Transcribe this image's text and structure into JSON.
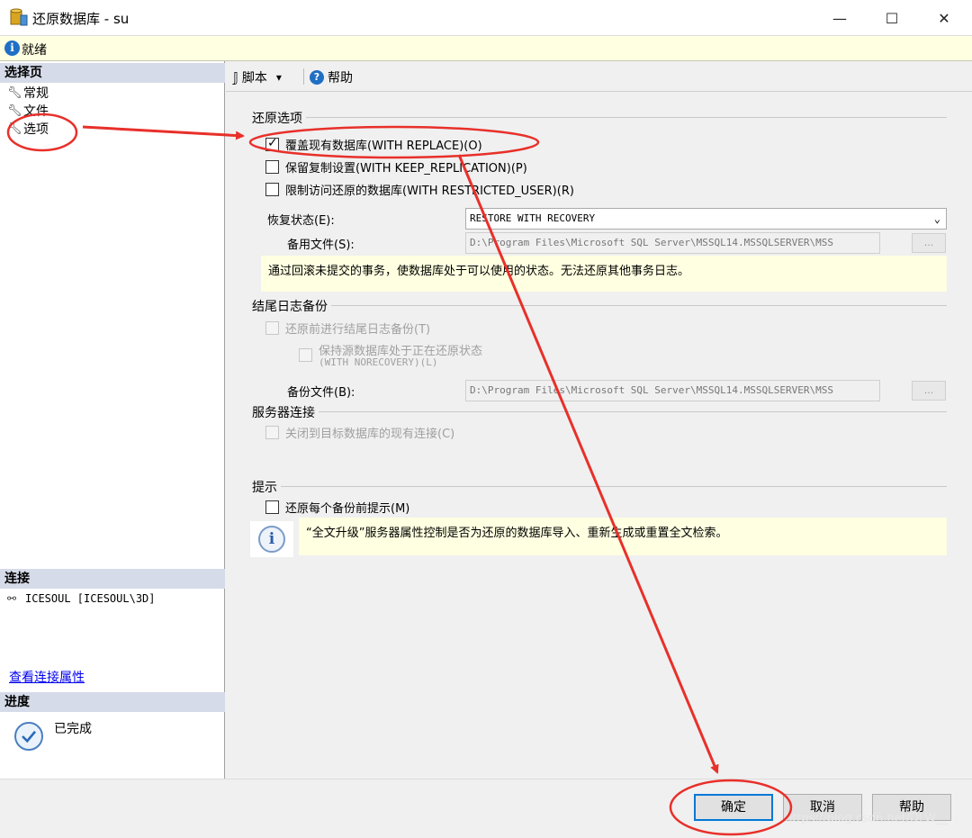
{
  "window": {
    "title": "还原数据库 - su",
    "minimize_glyph": "—",
    "maximize_glyph": "☐",
    "close_glyph": "✕"
  },
  "status": {
    "icon": "info-icon",
    "text": "就绪"
  },
  "left_panel": {
    "select_page_header": "选择页",
    "pages": [
      {
        "label": "常规",
        "icon": "wrench-icon"
      },
      {
        "label": "文件",
        "icon": "wrench-icon"
      },
      {
        "label": "选项",
        "icon": "wrench-icon"
      }
    ],
    "connection_header": "连接",
    "connection_text": "ICESOUL [ICESOUL\\3D]",
    "connection_link": "查看连接属性",
    "progress_header": "进度",
    "progress_text": "已完成"
  },
  "toolbar": {
    "script_label": "脚本",
    "dropdown_glyph": "▾",
    "help_label": "帮助"
  },
  "restore_options": {
    "group_title": "还原选项",
    "overwrite": {
      "label": "覆盖现有数据库(WITH REPLACE)(O)",
      "checked": true
    },
    "keep_replication": {
      "label": "保留复制设置(WITH KEEP_REPLICATION)(P)",
      "checked": false
    },
    "restricted_user": {
      "label": "限制访问还原的数据库(WITH RESTRICTED_USER)(R)",
      "checked": false
    },
    "recovery_state_label": "恢复状态(E):",
    "recovery_state_value": "RESTORE WITH RECOVERY",
    "standby_file_label": "备用文件(S):",
    "standby_file_value": "D:\\Program Files\\Microsoft SQL Server\\MSSQL14.MSSQLSERVER\\MSS",
    "browse_glyph": "...",
    "recovery_note": "通过回滚未提交的事务，使数据库处于可以使用的状态。无法还原其他事务日志。"
  },
  "tail_log": {
    "group_title": "结尾日志备份",
    "backup_before_restore": {
      "label": "还原前进行结尾日志备份(T)",
      "checked": false
    },
    "leave_restoring": {
      "label": "保持源数据库处于正在还原状态",
      "sublabel": "(WITH NORECOVERY)(L)",
      "checked": false
    },
    "backup_file_label": "备份文件(B):",
    "backup_file_value": "D:\\Program Files\\Microsoft SQL Server\\MSSQL14.MSSQLSERVER\\MSS"
  },
  "server_connections": {
    "group_title": "服务器连接",
    "close_connections": {
      "label": "关闭到目标数据库的现有连接(C)",
      "checked": false
    }
  },
  "prompt": {
    "group_title": "提示",
    "prompt_each": {
      "label": "还原每个备份前提示(M)",
      "checked": false
    },
    "info_text": "“全文升级”服务器属性控制是否为还原的数据库导入、重新生成或重置全文检索。"
  },
  "buttons": {
    "ok": "确定",
    "cancel": "取消",
    "help": "帮助"
  },
  "watermark": "https://blog.csdn.net/DLW__",
  "annotation_color": "#e8302a"
}
